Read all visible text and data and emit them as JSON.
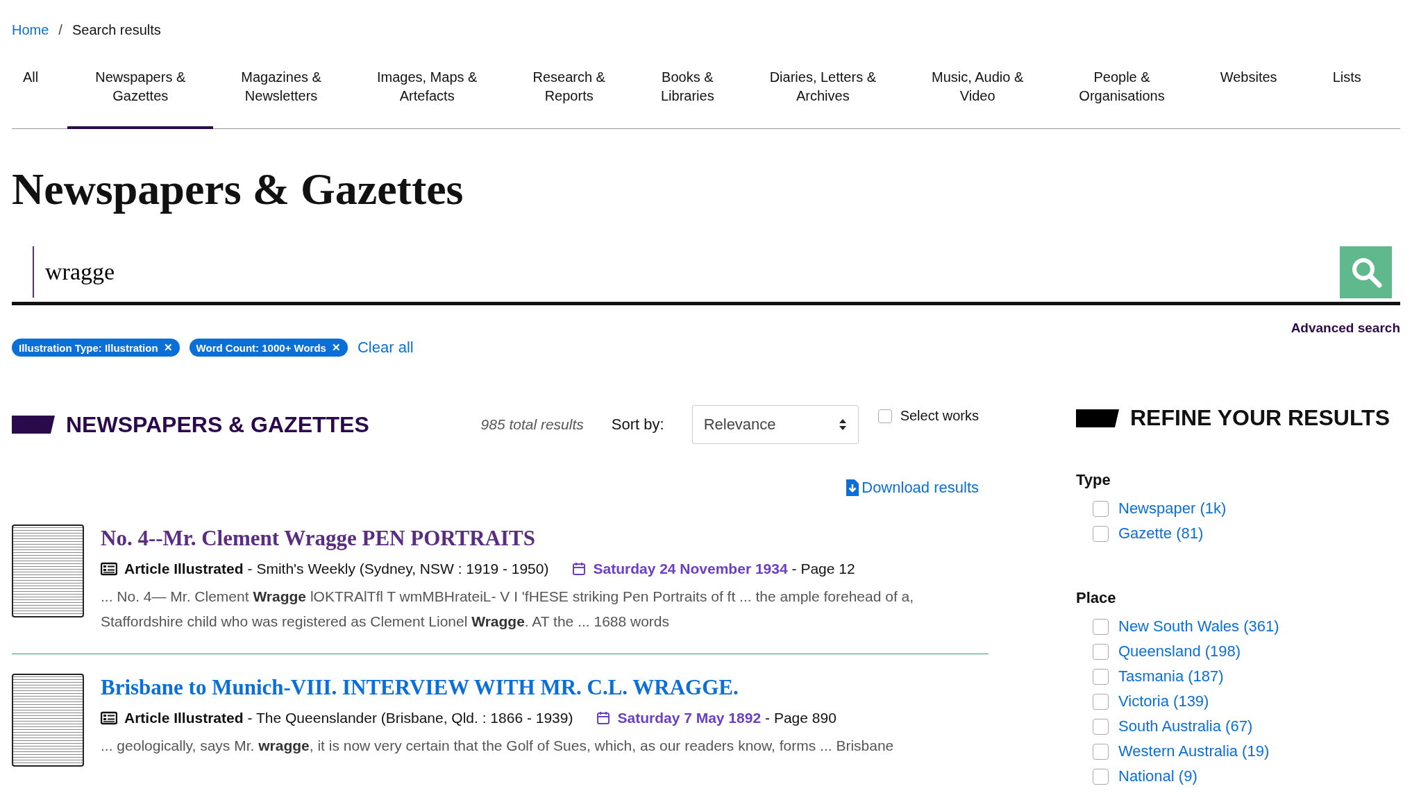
{
  "breadcrumb": [
    {
      "label": "Home",
      "kind": "link"
    },
    {
      "label": "/",
      "kind": "separator"
    },
    {
      "label": "Search results",
      "kind": "current"
    }
  ],
  "tabs": [
    {
      "label": "All",
      "selected": false
    },
    {
      "label": "Newspapers &\nGazettes",
      "selected": true
    },
    {
      "label": "Magazines &\nNewsletters",
      "selected": false
    },
    {
      "label": "Images, Maps &\nArtefacts",
      "selected": false
    },
    {
      "label": "Research &\nReports",
      "selected": false
    },
    {
      "label": "Books &\nLibraries",
      "selected": false
    },
    {
      "label": "Diaries, Letters &\nArchives",
      "selected": false
    },
    {
      "label": "Music, Audio &\nVideo",
      "selected": false
    },
    {
      "label": "People &\nOrganisations",
      "selected": false
    },
    {
      "label": "Websites",
      "selected": false
    },
    {
      "label": "Lists",
      "selected": false
    }
  ],
  "heading": "Newspapers & Gazettes",
  "search": {
    "value": "wragge"
  },
  "advanced_search": "Advanced search",
  "filters": [
    {
      "label": "Illustration Type: Illustration",
      "remove": "✕"
    },
    {
      "label": "Word Count: 1000+ Words",
      "remove": "✕"
    }
  ],
  "clear_all": "Clear all",
  "results_section": {
    "title": "NEWSPAPERS & GAZETTES",
    "total": "985 total results",
    "sort_label": "Sort by:",
    "sort_value": "Relevance",
    "select_works": {
      "label": "Select works",
      "checked": false
    },
    "download": "Download results"
  },
  "results": [
    {
      "title": "No. 4--Mr. Clement Wragge PEN PORTRAITS",
      "visited": true,
      "type": "Article Illustrated",
      "source": "- Smith's Weekly (Sydney, NSW : 1919 - 1950)",
      "date": "Saturday 24 November 1934",
      "page": "- Page 12",
      "snippet": "... No. 4— Mr. Clement **Wragge** lOKTRAlTfl T wmMBHrateiL- V I 'fHESE striking Pen Portraits of ft ... the ample forehead of a, Staffordshire child who was registered as Clement Lionel **Wragge**. AT the ... 1688 words"
    },
    {
      "title": "Brisbane to Munich-VIII. INTERVIEW WITH MR. C.L. WRAGGE.",
      "visited": false,
      "type": "Article Illustrated",
      "source": "- The Queenslander (Brisbane, Qld. : 1866 - 1939)",
      "date": "Saturday 7 May 1892",
      "page": "- Page 890",
      "snippet": "... geologically, says Mr. **wragge**, it is now very certain that the Golf of Sues, which, as our readers know, forms ... Brisbane"
    }
  ],
  "refine": {
    "title": "REFINE YOUR RESULTS",
    "groups": [
      {
        "title": "Type",
        "options": [
          {
            "label": "Newspaper (1k)",
            "checked": false
          },
          {
            "label": "Gazette (81)",
            "checked": false
          }
        ]
      },
      {
        "title": "Place",
        "options": [
          {
            "label": "New South Wales (361)",
            "checked": false
          },
          {
            "label": "Queensland (198)",
            "checked": false
          },
          {
            "label": "Tasmania (187)",
            "checked": false
          },
          {
            "label": "Victoria (139)",
            "checked": false
          },
          {
            "label": "South Australia (67)",
            "checked": false
          },
          {
            "label": "Western Australia (19)",
            "checked": false
          },
          {
            "label": "National (9)",
            "checked": false
          }
        ]
      }
    ]
  }
}
